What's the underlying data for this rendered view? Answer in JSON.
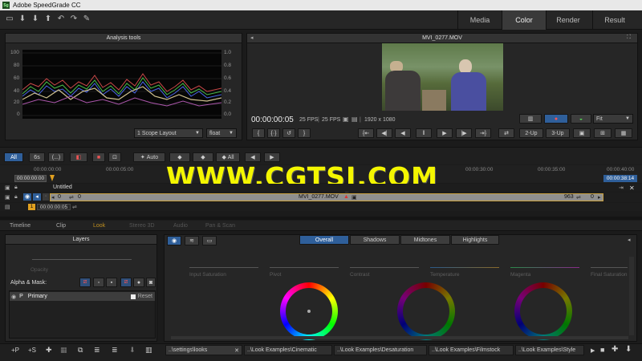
{
  "app": {
    "title": "Adobe SpeedGrade CC"
  },
  "mode_tabs": [
    "Media",
    "Color",
    "Render",
    "Result"
  ],
  "active_mode": "Color",
  "analysis": {
    "title": "Analysis tools",
    "left_ticks": [
      "100",
      "80",
      "60",
      "40",
      "20",
      "0"
    ],
    "right_ticks": [
      "1.0",
      "0.8",
      "0.6",
      "0.4",
      "0.2",
      "0.0"
    ],
    "layout_select": "1 Scope Layout",
    "precision_select": "float"
  },
  "viewer": {
    "clip_name": "MVI_0277.MOV",
    "timecode": "00:00:00:05",
    "fps_a": "25 FPS",
    "fps_b": "25 FPS",
    "resolution": "1920 x 1080",
    "fit_select": "Fit",
    "layout_2up": "2-Up",
    "layout_3up": "3-Up"
  },
  "timeline_toolbar": {
    "all_label": "All",
    "six_s": "6s",
    "ellipsis": "(...)",
    "auto_label": "Auto",
    "all2_label": "All"
  },
  "timeline": {
    "ruler": [
      "00:00:00:00",
      "00:00:05:00",
      "00:00:30:00",
      "00:00:35:00",
      "00:00:40:00"
    ],
    "current_tc": "00:00:00:00",
    "end_tc": "00:00:38:14",
    "track_name": "Untitled",
    "clip_name": "MVI_0277.MOV",
    "clip_in": "0",
    "clip_offset": "0",
    "clip_frames": "963",
    "clip_end": "0",
    "track_num": "1",
    "track_tc": "00:00:00:05"
  },
  "watermark": "WWW.CGTSJ.COM",
  "lower_tabs": [
    "Timeline",
    "Clip",
    "Look",
    "Stereo 3D",
    "Audio",
    "Pan & Scan"
  ],
  "active_lower_tab": "Look",
  "layers": {
    "title": "Layers",
    "opacity_label": "Opacity",
    "alpha_mask_label": "Alpha & Mask:",
    "layer_p": "P",
    "layer_name": "Primary",
    "reset_label": "Reset"
  },
  "color_tabs": [
    "Overall",
    "Shadows",
    "Midtones",
    "Highlights"
  ],
  "active_color_tab": "Overall",
  "sliders": [
    "Input Saturation",
    "Pivot",
    "Contrast",
    "Temperature",
    "Magenta",
    "Final Saturation"
  ],
  "bottom_bar": {
    "add_p": "+P",
    "add_s": "+S"
  },
  "look_tabs": [
    "..\\settings\\looks",
    "..\\Look Examples\\Cinematic",
    "..\\Look Examples\\Desaturation",
    "..\\Look Examples\\Filmstock",
    "..\\Look Examples\\Style"
  ],
  "colors": {
    "accent": "#2f5f9a",
    "track_orange": "#e0a020",
    "clip_bar": "#8f8f8f",
    "watermark": "#f4f600"
  }
}
